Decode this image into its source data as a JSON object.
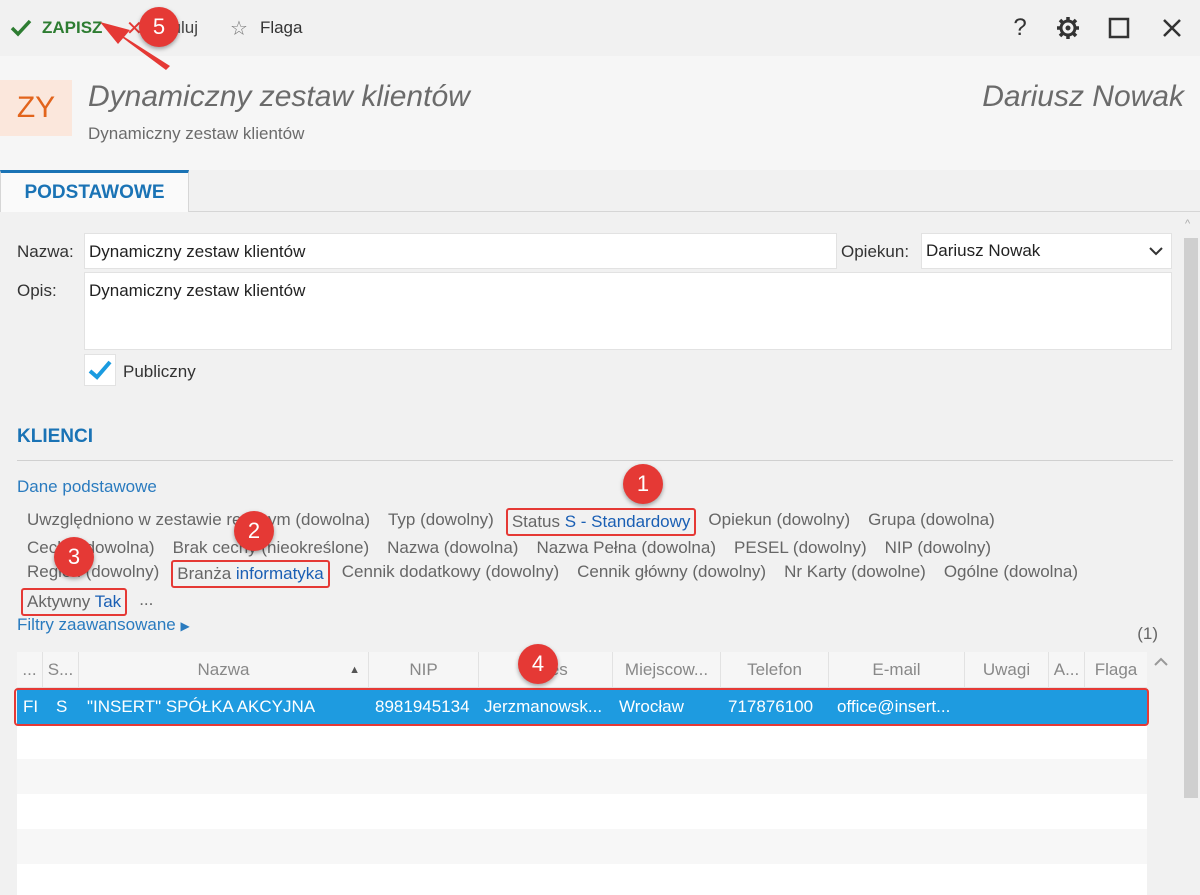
{
  "toolbar": {
    "save_label": "ZAPISZ",
    "cancel_label": "Anuluj",
    "flag_label": "Flaga",
    "help_icon": "question-mark",
    "settings_icon": "gear",
    "maximize_icon": "square",
    "close_icon": "x"
  },
  "header": {
    "avatar_text": "ZY",
    "title": "Dynamiczny zestaw klientów",
    "subtitle": "Dynamiczny zestaw klientów",
    "user": "Dariusz Nowak"
  },
  "tabs": [
    {
      "label": "PODSTAWOWE",
      "active": true
    }
  ],
  "form": {
    "name_label": "Nazwa:",
    "name_value": "Dynamiczny zestaw klientów",
    "opiekun_label": "Opiekun:",
    "opiekun_value": "Dariusz Nowak",
    "opis_label": "Opis:",
    "opis_value": "Dynamiczny zestaw klientów",
    "public_label": "Publiczny",
    "public_checked": true
  },
  "clients": {
    "section_title": "KLIENCI",
    "basic_link": "Dane podstawowe",
    "filter_rows": [
      [
        {
          "label": "Uwzględniono w zestawie ręcznym",
          "value": "",
          "suffix": " (dowolna)",
          "boxed": false
        },
        {
          "label": "Typ",
          "value": "",
          "suffix": " (dowolny)",
          "boxed": false
        },
        {
          "label": "Status ",
          "value": "S - Standardowy",
          "suffix": "",
          "boxed": true
        },
        {
          "label": "Opiekun",
          "value": "",
          "suffix": " (dowolny)",
          "boxed": false
        },
        {
          "label": "Grupa",
          "value": "",
          "suffix": " (dowolna)",
          "boxed": false
        }
      ],
      [
        {
          "label": "Cechy",
          "value": "",
          "suffix": " (dowolna)",
          "boxed": false
        },
        {
          "label": "Brak cechy",
          "value": "",
          "suffix": " (nieokreślone)",
          "boxed": false
        },
        {
          "label": "Nazwa",
          "value": "",
          "suffix": " (dowolna)",
          "boxed": false
        },
        {
          "label": "Nazwa Pełna",
          "value": "",
          "suffix": " (dowolna)",
          "boxed": false
        },
        {
          "label": "PESEL",
          "value": "",
          "suffix": " (dowolny)",
          "boxed": false
        },
        {
          "label": "NIP",
          "value": "",
          "suffix": " (dowolny)",
          "boxed": false
        }
      ],
      [
        {
          "label": "Region",
          "value": "",
          "suffix": " (dowolny)",
          "boxed": false
        },
        {
          "label": "Branża ",
          "value": "informatyka",
          "suffix": "",
          "boxed": true
        },
        {
          "label": "Cennik dodatkowy",
          "value": "",
          "suffix": " (dowolny)",
          "boxed": false
        },
        {
          "label": "Cennik główny",
          "value": "",
          "suffix": " (dowolny)",
          "boxed": false
        },
        {
          "label": "Nr Karty",
          "value": "",
          "suffix": " (dowolne)",
          "boxed": false
        },
        {
          "label": "Ogólne",
          "value": "",
          "suffix": " (dowolna)",
          "boxed": false
        }
      ],
      [
        {
          "label": "Aktywny ",
          "value": "Tak",
          "suffix": "",
          "boxed": true
        },
        {
          "label": "...",
          "value": "",
          "suffix": "",
          "boxed": false
        }
      ]
    ],
    "advanced_link": "Filtry zaawansowane",
    "count": "(1)",
    "columns": [
      "...",
      "S...",
      "Nazwa",
      "NIP",
      "Adres",
      "Miejscow...",
      "Telefon",
      "E-mail",
      "Uwagi",
      "A...",
      "Flaga"
    ],
    "rows": [
      [
        "FI",
        "S",
        "\"INSERT\" SPÓŁKA AKCYJNA",
        "8981945134",
        "Jerzmanowsk...",
        "Wrocław",
        "717876100",
        "office@insert...",
        "",
        "",
        ""
      ]
    ]
  },
  "annotations": [
    "1",
    "2",
    "3",
    "4",
    "5"
  ],
  "colors": {
    "accent": "#1a73b5",
    "selected_row": "#1e9be0",
    "annotation_red": "#e53935",
    "save_green": "#2e7d32",
    "avatar_bg": "#fbe7dc",
    "avatar_text": "#e2641c"
  }
}
